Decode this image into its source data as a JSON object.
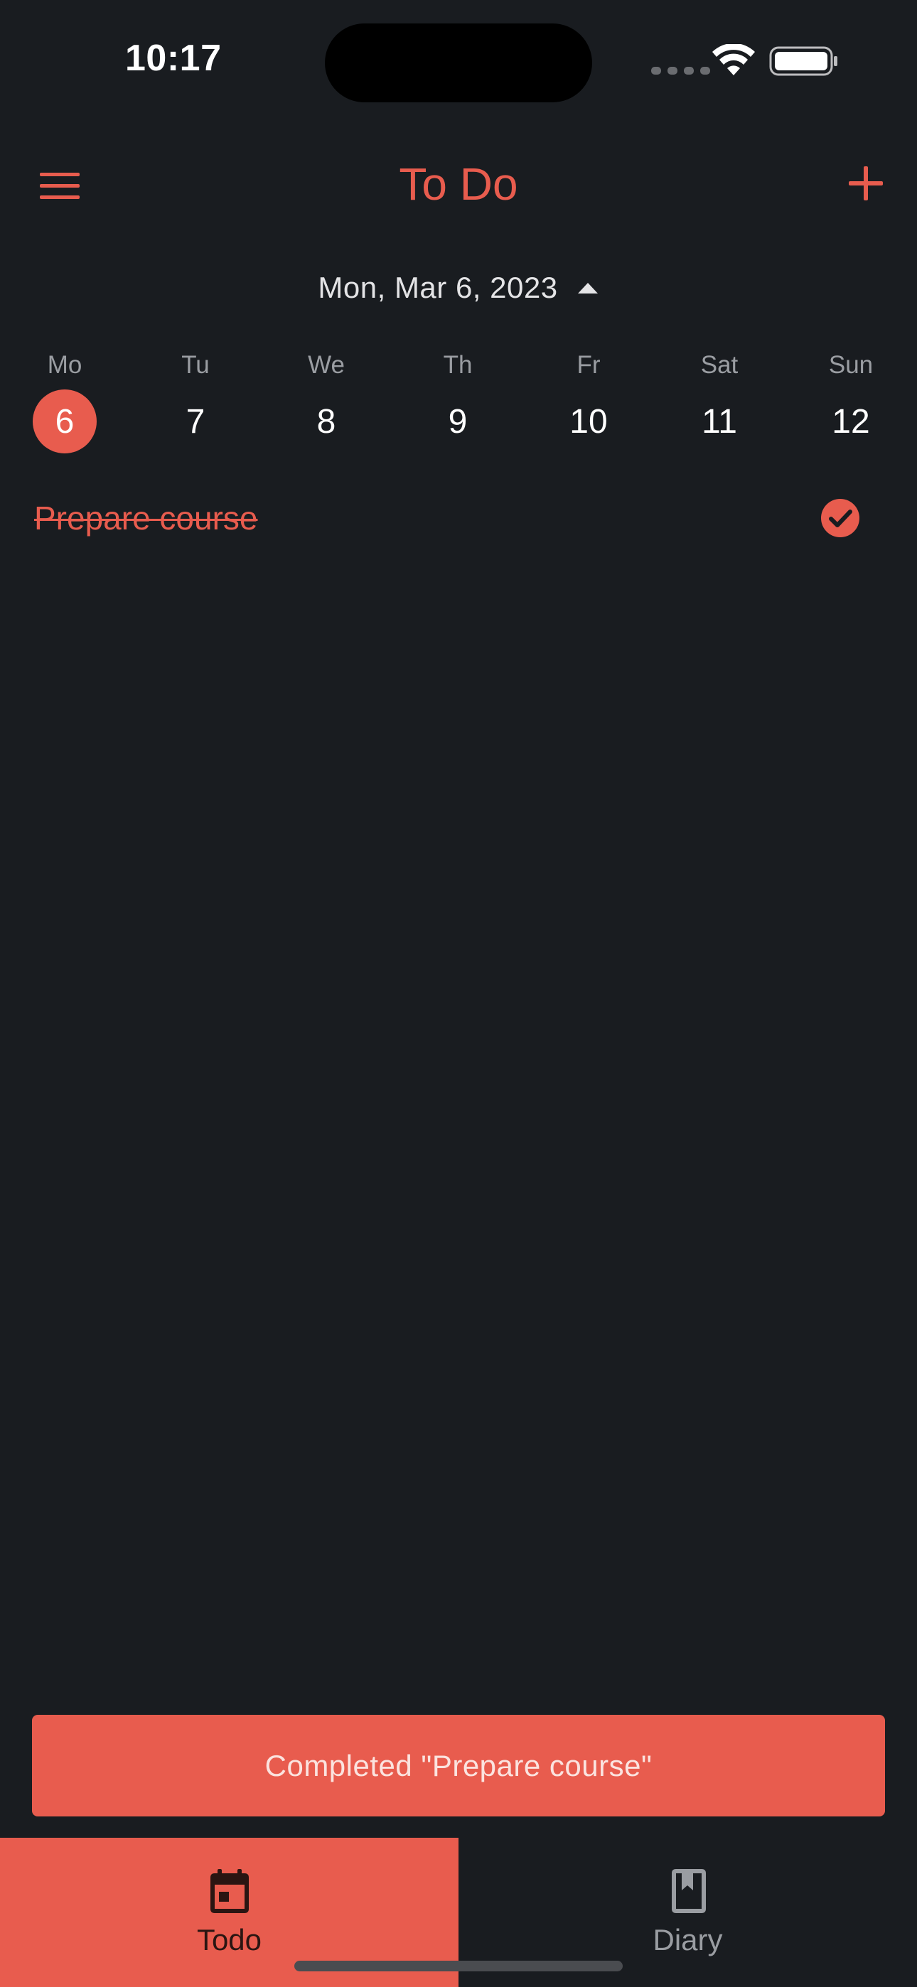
{
  "status_bar": {
    "time": "10:17"
  },
  "app_bar": {
    "title": "To Do",
    "menu_icon": "menu-icon",
    "add_icon": "plus-icon"
  },
  "date_selector": {
    "label": "Mon, Mar 6, 2023",
    "toggle_icon": "caret-up-icon"
  },
  "week": [
    {
      "day": "Mo",
      "date": "6",
      "selected": true
    },
    {
      "day": "Tu",
      "date": "7",
      "selected": false
    },
    {
      "day": "We",
      "date": "8",
      "selected": false
    },
    {
      "day": "Th",
      "date": "9",
      "selected": false
    },
    {
      "day": "Fr",
      "date": "10",
      "selected": false
    },
    {
      "day": "Sat",
      "date": "11",
      "selected": false
    },
    {
      "day": "Sun",
      "date": "12",
      "selected": false
    }
  ],
  "tasks": [
    {
      "title": "Prepare course",
      "completed": true,
      "status_icon": "check-circle-icon"
    }
  ],
  "snackbar": {
    "message": "Completed \"Prepare course\""
  },
  "bottom_nav": {
    "items": [
      {
        "label": "Todo",
        "icon": "calendar-icon",
        "active": true
      },
      {
        "label": "Diary",
        "icon": "bookmark-book-icon",
        "active": false
      }
    ]
  },
  "colors": {
    "accent": "#e85c4e",
    "background": "#191c20",
    "muted_text": "#9a9da2"
  }
}
